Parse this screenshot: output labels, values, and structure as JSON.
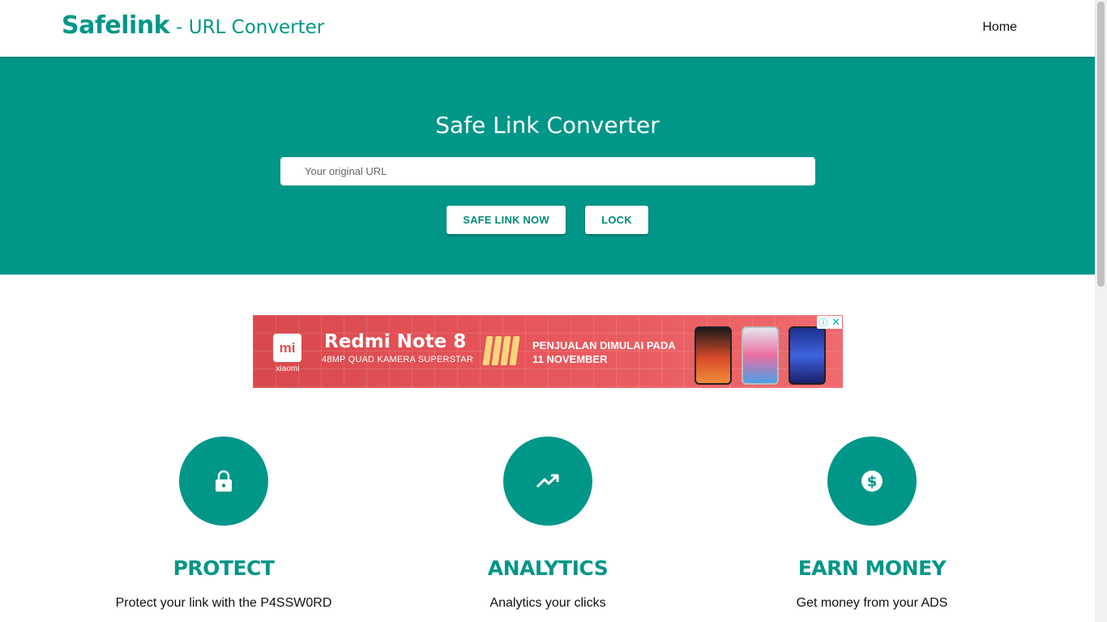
{
  "navbar": {
    "brand_name": "Safelink",
    "brand_subtitle": "- URL Converter",
    "home_link": "Home"
  },
  "hero": {
    "title": "Safe Link Converter",
    "url_placeholder": "Your original URL",
    "url_value": "",
    "safe_link_button": "SAFE LINK NOW",
    "lock_button": "LOCK"
  },
  "ad": {
    "brand_logo_text": "mi",
    "brand_word": "xiaomi",
    "title": "Redmi Note 8",
    "subtitle": "48MP QUAD KAMERA SUPERSTAR",
    "sale_line1": "PENJUALAN DIMULAI PADA",
    "sale_line2": "11 NOVEMBER",
    "choices_icon": "ⓘ",
    "close_icon": "✕"
  },
  "features": [
    {
      "icon": "lock-icon",
      "title": "PROTECT",
      "description": "Protect your link with the P4SSW0RD"
    },
    {
      "icon": "trending-up-icon",
      "title": "ANALYTICS",
      "description": "Analytics your clicks"
    },
    {
      "icon": "dollar-icon",
      "title": "EARN MONEY",
      "description": "Get money from your ADS"
    }
  ],
  "colors": {
    "primary": "#009688",
    "button_text": "#00897b",
    "ad_background": "#e6555a"
  }
}
